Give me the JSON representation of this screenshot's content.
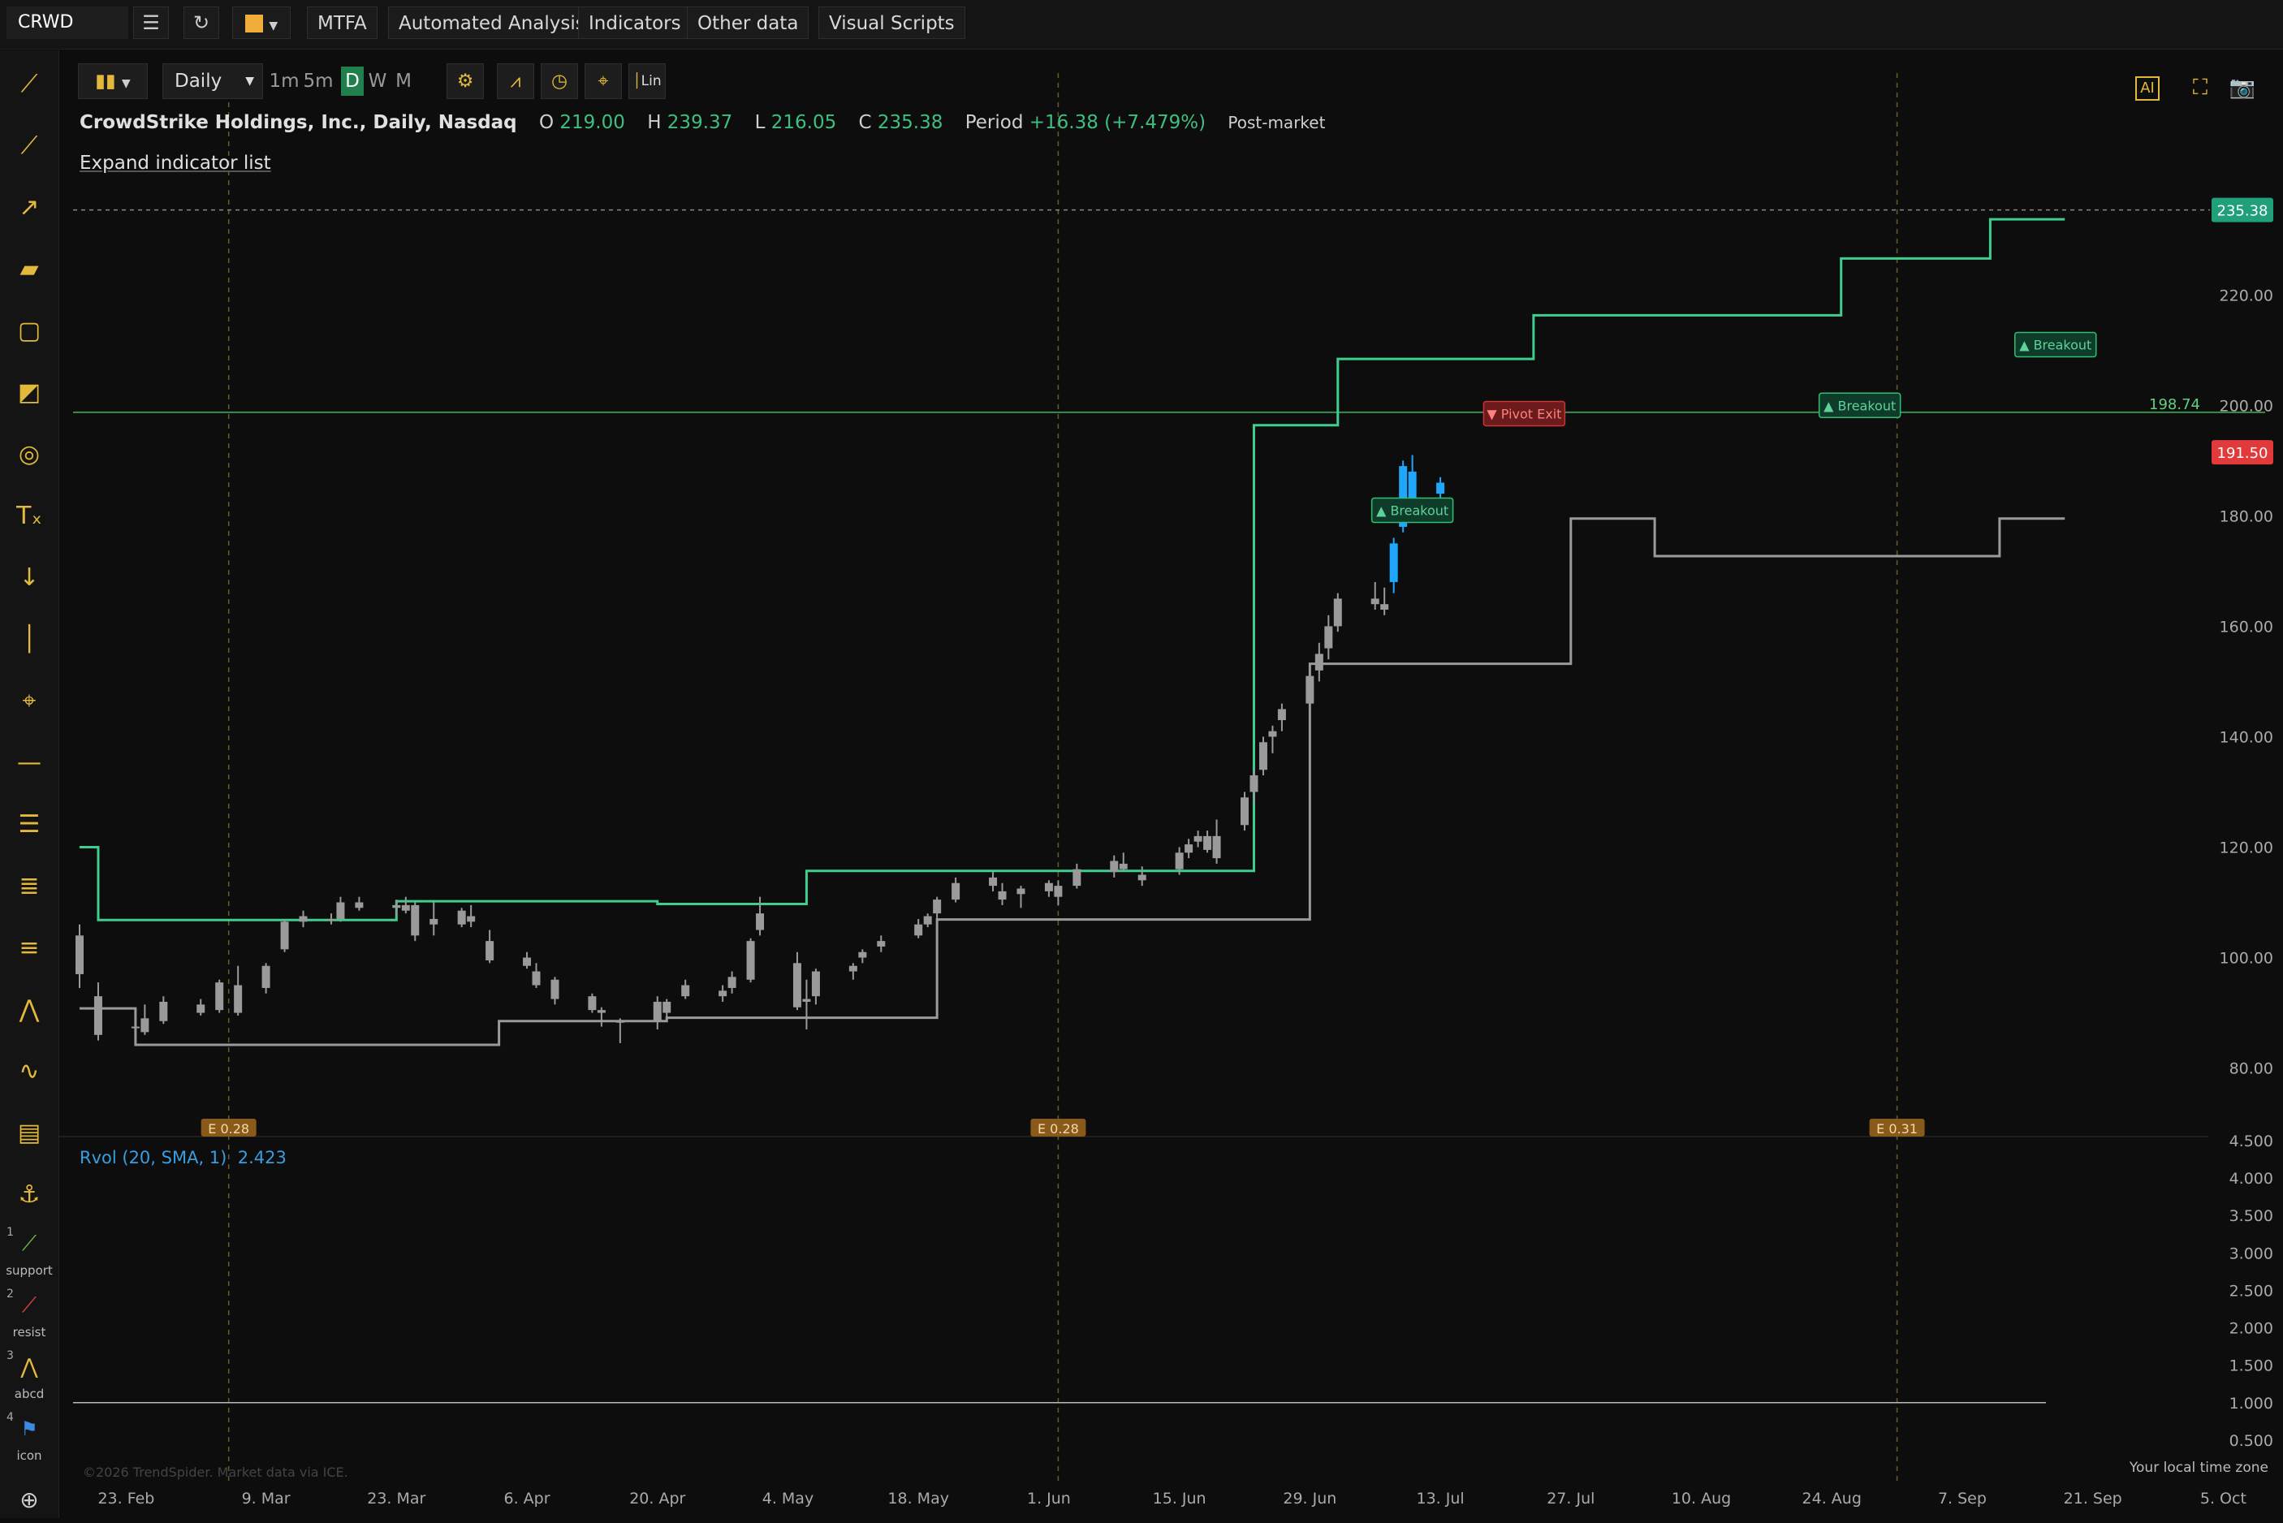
{
  "app": {
    "symbol": "CRWD",
    "toolbar": {
      "mtfa": "MTFA",
      "automated_analysis": "Automated Analysis",
      "indicators": "Indicators",
      "other_data": "Other data",
      "visual_scripts": "Visual Scripts"
    },
    "chart_toolbar": {
      "interval": "Daily",
      "timeframes": [
        "1m",
        "5m",
        "D",
        "W",
        "M"
      ],
      "active_timeframe": "D",
      "lin_label": "Lin"
    },
    "left_tools": [
      {
        "num": "1",
        "label": "support"
      },
      {
        "num": "2",
        "label": "resist"
      },
      {
        "num": "3",
        "label": "abcd"
      },
      {
        "num": "4",
        "label": "icon"
      }
    ],
    "header": {
      "title": "CrowdStrike Holdings, Inc., Daily, Nasdaq",
      "o_label": "O",
      "o_value": "219.00",
      "h_label": "H",
      "h_value": "239.37",
      "l_label": "L",
      "l_value": "216.05",
      "c_label": "C",
      "c_value": "235.38",
      "period_label": "Period",
      "period_value": "+16.38 (+7.479%)",
      "post_market": "Post-market"
    },
    "expand_label": "Expand indicator list",
    "rvol": {
      "label": "Rvol (20, SMA, 1)",
      "value": "2.423"
    },
    "copyright": "©2026 TrendSpider. Market data via ICE.",
    "local_tz": "Your local time zone",
    "colors": {
      "up": "#2fbf71",
      "down": "#2fbf71",
      "blue": "#1ea7fd",
      "gray": "#9a9a9a",
      "red": "#e03a3a",
      "accent": "#e2b93b"
    }
  },
  "chart_data": [
    {
      "type": "candlestick",
      "title": "CrowdStrike Holdings, Inc., Daily, Nasdaq",
      "ylim": [
        72,
        244
      ],
      "y_ticks": [
        "80.00",
        "100.00",
        "120.00",
        "140.00",
        "160.00",
        "180.00",
        "200.00",
        "220.00"
      ],
      "x_ticks": [
        "23. Feb",
        "9. Mar",
        "23. Mar",
        "6. Apr",
        "20. Apr",
        "4. May",
        "18. May",
        "1. Jun",
        "15. Jun",
        "29. Jun",
        "13. Jul",
        "27. Jul",
        "10. Aug",
        "24. Aug",
        "7. Sep",
        "21. Sep",
        "5. Oct"
      ],
      "last_price": "235.38",
      "level_line": {
        "value": 198.74,
        "label": "198.74"
      },
      "red_level": {
        "value": 191.5,
        "label": "191.50"
      },
      "earnings": [
        {
          "label": "E 0.28",
          "date": "2020-03-05"
        },
        {
          "label": "E 0.28",
          "date": "2020-06-02"
        },
        {
          "label": "E 0.31",
          "date": "2020-08-31"
        }
      ],
      "signals": [
        {
          "label": "▲ Breakout",
          "date": "2020-07-10",
          "value": 181.0
        },
        {
          "label": "▼ Pivot Exit",
          "date": "2020-07-22",
          "value": 198.5
        },
        {
          "label": "▲ Breakout",
          "date": "2020-08-27",
          "value": 200.0
        },
        {
          "label": "▲ Breakout",
          "date": "2020-09-17",
          "value": 211.0
        }
      ],
      "candles": [
        {
          "date": "2020-02-18",
          "o": 104.0,
          "h": 106.0,
          "l": 94.5,
          "c": 97.0,
          "color": "gray"
        },
        {
          "date": "2020-02-20",
          "o": 93.0,
          "h": 95.5,
          "l": 85.0,
          "c": 86.0,
          "color": "gray"
        },
        {
          "date": "2020-02-24",
          "o": 87.5,
          "h": 89.0,
          "l": 85.5,
          "c": 87.5,
          "color": "gray"
        },
        {
          "date": "2020-02-25",
          "o": 89.0,
          "h": 91.5,
          "l": 86.0,
          "c": 86.5,
          "color": "gray"
        },
        {
          "date": "2020-02-27",
          "o": 88.5,
          "h": 93.0,
          "l": 88.0,
          "c": 92.0,
          "color": "gray"
        },
        {
          "date": "2020-03-02",
          "o": 90.0,
          "h": 92.5,
          "l": 89.5,
          "c": 91.5,
          "color": "gray"
        },
        {
          "date": "2020-03-04",
          "o": 90.5,
          "h": 96.0,
          "l": 90.0,
          "c": 95.5,
          "color": "gray"
        },
        {
          "date": "2020-03-06",
          "o": 95.0,
          "h": 98.5,
          "l": 89.5,
          "c": 90.0,
          "color": "gray"
        },
        {
          "date": "2020-03-09",
          "o": 94.5,
          "h": 99.0,
          "l": 93.5,
          "c": 98.5,
          "color": "gray"
        },
        {
          "date": "2020-03-11",
          "o": 101.5,
          "h": 107.0,
          "l": 101.0,
          "c": 106.5,
          "color": "gray"
        },
        {
          "date": "2020-03-13",
          "o": 106.5,
          "h": 108.5,
          "l": 105.5,
          "c": 107.5,
          "color": "gray"
        },
        {
          "date": "2020-03-16",
          "o": 107.0,
          "h": 108.0,
          "l": 106.0,
          "c": 107.0,
          "color": "gray"
        },
        {
          "date": "2020-03-17",
          "o": 107.0,
          "h": 111.0,
          "l": 106.5,
          "c": 110.0,
          "color": "gray"
        },
        {
          "date": "2020-03-19",
          "o": 110.0,
          "h": 111.0,
          "l": 108.5,
          "c": 109.0,
          "color": "gray"
        },
        {
          "date": "2020-03-23",
          "o": 109.0,
          "h": 110.5,
          "l": 107.5,
          "c": 109.5,
          "color": "gray"
        },
        {
          "date": "2020-03-24",
          "o": 109.5,
          "h": 111.0,
          "l": 108.0,
          "c": 108.5,
          "color": "gray"
        },
        {
          "date": "2020-03-25",
          "o": 104.0,
          "h": 110.0,
          "l": 103.0,
          "c": 109.5,
          "color": "gray"
        },
        {
          "date": "2020-03-27",
          "o": 107.0,
          "h": 110.0,
          "l": 104.0,
          "c": 106.0,
          "color": "gray"
        },
        {
          "date": "2020-03-30",
          "o": 108.5,
          "h": 109.0,
          "l": 105.5,
          "c": 106.0,
          "color": "gray"
        },
        {
          "date": "2020-03-31",
          "o": 107.5,
          "h": 109.5,
          "l": 105.5,
          "c": 106.5,
          "color": "gray"
        },
        {
          "date": "2020-04-02",
          "o": 103.0,
          "h": 105.0,
          "l": 99.0,
          "c": 99.5,
          "color": "gray"
        },
        {
          "date": "2020-04-06",
          "o": 100.0,
          "h": 101.0,
          "l": 98.0,
          "c": 98.5,
          "color": "gray"
        },
        {
          "date": "2020-04-07",
          "o": 97.5,
          "h": 99.0,
          "l": 94.5,
          "c": 95.0,
          "color": "gray"
        },
        {
          "date": "2020-04-09",
          "o": 92.5,
          "h": 96.5,
          "l": 91.5,
          "c": 96.0,
          "color": "gray"
        },
        {
          "date": "2020-04-13",
          "o": 90.5,
          "h": 93.5,
          "l": 90.0,
          "c": 93.0,
          "color": "gray"
        },
        {
          "date": "2020-04-14",
          "o": 90.5,
          "h": 91.0,
          "l": 87.5,
          "c": 90.0,
          "color": "gray"
        },
        {
          "date": "2020-04-16",
          "o": 88.5,
          "h": 89.0,
          "l": 84.5,
          "c": 88.5,
          "color": "gray"
        },
        {
          "date": "2020-04-20",
          "o": 88.5,
          "h": 93.0,
          "l": 87.0,
          "c": 92.0,
          "color": "gray"
        },
        {
          "date": "2020-04-21",
          "o": 90.0,
          "h": 92.5,
          "l": 89.0,
          "c": 92.0,
          "color": "gray"
        },
        {
          "date": "2020-04-23",
          "o": 93.0,
          "h": 96.0,
          "l": 92.5,
          "c": 95.0,
          "color": "gray"
        },
        {
          "date": "2020-04-27",
          "o": 93.0,
          "h": 95.0,
          "l": 92.0,
          "c": 94.0,
          "color": "gray"
        },
        {
          "date": "2020-04-28",
          "o": 94.5,
          "h": 97.5,
          "l": 93.5,
          "c": 96.5,
          "color": "gray"
        },
        {
          "date": "2020-04-30",
          "o": 96.0,
          "h": 103.5,
          "l": 95.5,
          "c": 103.0,
          "color": "gray"
        },
        {
          "date": "2020-05-01",
          "o": 105.0,
          "h": 111.0,
          "l": 104.0,
          "c": 108.0,
          "color": "gray"
        },
        {
          "date": "2020-05-05",
          "o": 99.0,
          "h": 101.0,
          "l": 90.5,
          "c": 91.0,
          "color": "gray"
        },
        {
          "date": "2020-05-06",
          "o": 92.0,
          "h": 96.0,
          "l": 87.0,
          "c": 92.5,
          "color": "gray"
        },
        {
          "date": "2020-05-07",
          "o": 93.0,
          "h": 98.0,
          "l": 91.5,
          "c": 97.5,
          "color": "gray"
        },
        {
          "date": "2020-05-11",
          "o": 97.5,
          "h": 99.0,
          "l": 96.0,
          "c": 98.5,
          "color": "gray"
        },
        {
          "date": "2020-05-12",
          "o": 100.0,
          "h": 101.5,
          "l": 99.0,
          "c": 101.0,
          "color": "gray"
        },
        {
          "date": "2020-05-14",
          "o": 102.0,
          "h": 104.0,
          "l": 101.0,
          "c": 103.0,
          "color": "gray"
        },
        {
          "date": "2020-05-18",
          "o": 104.0,
          "h": 107.0,
          "l": 103.5,
          "c": 106.0,
          "color": "gray"
        },
        {
          "date": "2020-05-19",
          "o": 106.0,
          "h": 108.0,
          "l": 105.5,
          "c": 107.5,
          "color": "gray"
        },
        {
          "date": "2020-05-20",
          "o": 108.0,
          "h": 111.0,
          "l": 107.0,
          "c": 110.5,
          "color": "gray"
        },
        {
          "date": "2020-05-22",
          "o": 110.5,
          "h": 114.5,
          "l": 110.0,
          "c": 113.5,
          "color": "gray"
        },
        {
          "date": "2020-05-26",
          "o": 113.0,
          "h": 115.5,
          "l": 112.0,
          "c": 114.5,
          "color": "gray"
        },
        {
          "date": "2020-05-27",
          "o": 112.0,
          "h": 113.5,
          "l": 109.5,
          "c": 110.5,
          "color": "gray"
        },
        {
          "date": "2020-05-29",
          "o": 111.5,
          "h": 113.0,
          "l": 109.0,
          "c": 112.5,
          "color": "gray"
        },
        {
          "date": "2020-06-01",
          "o": 112.0,
          "h": 114.0,
          "l": 111.0,
          "c": 113.5,
          "color": "gray"
        },
        {
          "date": "2020-06-02",
          "o": 113.0,
          "h": 114.0,
          "l": 109.5,
          "c": 111.0,
          "color": "gray"
        },
        {
          "date": "2020-06-04",
          "o": 113.0,
          "h": 117.0,
          "l": 112.5,
          "c": 116.0,
          "color": "gray"
        },
        {
          "date": "2020-06-08",
          "o": 115.5,
          "h": 118.5,
          "l": 114.5,
          "c": 117.5,
          "color": "gray"
        },
        {
          "date": "2020-06-09",
          "o": 117.0,
          "h": 119.0,
          "l": 115.5,
          "c": 116.0,
          "color": "gray"
        },
        {
          "date": "2020-06-11",
          "o": 115.0,
          "h": 116.5,
          "l": 113.0,
          "c": 114.0,
          "color": "gray"
        },
        {
          "date": "2020-06-15",
          "o": 116.0,
          "h": 120.0,
          "l": 115.0,
          "c": 119.0,
          "color": "gray"
        },
        {
          "date": "2020-06-16",
          "o": 119.0,
          "h": 121.5,
          "l": 118.0,
          "c": 120.5,
          "color": "gray"
        },
        {
          "date": "2020-06-17",
          "o": 121.0,
          "h": 123.0,
          "l": 120.0,
          "c": 122.0,
          "color": "gray"
        },
        {
          "date": "2020-06-18",
          "o": 122.0,
          "h": 123.0,
          "l": 119.0,
          "c": 119.5,
          "color": "gray"
        }
      ],
      "note_levels": {
        "upper": [
          {
            "from": "2020-02-18",
            "to": "2020-02-20",
            "value": 120.0
          },
          {
            "from": "2020-02-20",
            "to": "2020-03-23",
            "value": 106.8
          },
          {
            "from": "2020-03-23",
            "to": "2020-04-20",
            "value": 110.2
          },
          {
            "from": "2020-04-20",
            "to": "2020-05-06",
            "value": 109.7
          },
          {
            "from": "2020-05-06",
            "to": "2020-06-23",
            "value": 115.7
          },
          {
            "from": "2020-06-23",
            "to": "2020-07-02",
            "value": 196.4
          },
          {
            "from": "2020-07-02",
            "to": "2020-07-23",
            "value": 208.4
          },
          {
            "from": "2020-07-23",
            "to": "2020-08-25",
            "value": 216.3
          },
          {
            "from": "2020-08-25",
            "to": "2020-09-10",
            "value": 226.6
          },
          {
            "from": "2020-09-10",
            "to": "2020-09-18",
            "value": 233.7
          }
        ],
        "lower": [
          {
            "from": "2020-02-18",
            "to": "2020-02-24",
            "value": 90.8
          },
          {
            "from": "2020-02-24",
            "to": "2020-04-03",
            "value": 84.2
          },
          {
            "from": "2020-04-03",
            "to": "2020-04-21",
            "value": 88.5
          },
          {
            "from": "2020-04-21",
            "to": "2020-05-20",
            "value": 89.1
          },
          {
            "from": "2020-05-20",
            "to": "2020-06-29",
            "value": 106.9
          },
          {
            "from": "2020-06-29",
            "to": "2020-07-27",
            "value": 153.2
          },
          {
            "from": "2020-07-27",
            "to": "2020-08-05",
            "value": 179.5
          },
          {
            "from": "2020-08-05",
            "to": "2020-09-11",
            "value": 172.7
          },
          {
            "from": "2020-09-11",
            "to": "2020-09-18",
            "value": 179.5
          }
        ]
      }
    },
    {
      "type": "area",
      "title": "Rvol (20, SMA, 1)",
      "ylim": [
        0.0,
        4.5
      ],
      "baseline": 1.0,
      "y_ticks": [
        "0.500",
        "1.000",
        "1.500",
        "2.000",
        "2.500",
        "3.000",
        "3.500",
        "4.000",
        "4.500"
      ],
      "last_value": "2.423"
    }
  ]
}
